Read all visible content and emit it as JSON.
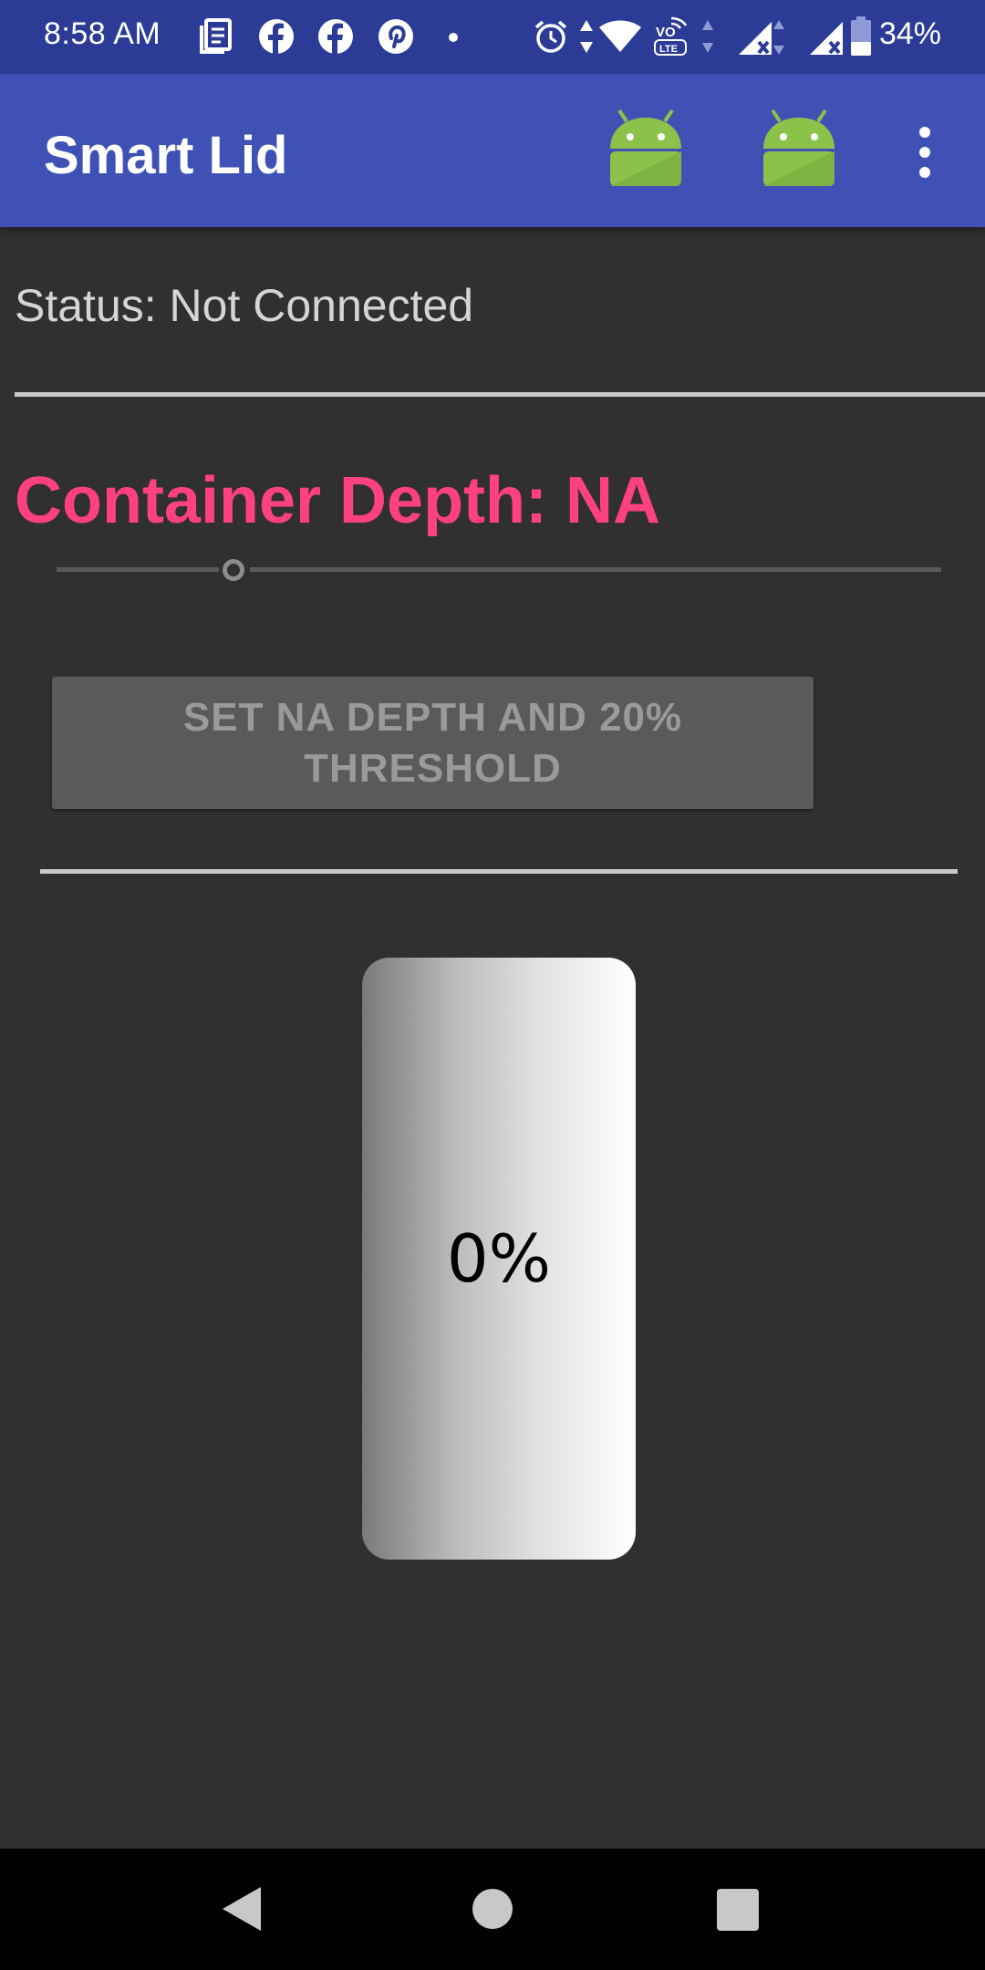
{
  "status_bar": {
    "time": "8:58 AM",
    "battery_percent": "34%",
    "icons": [
      "news-icon",
      "facebook-icon",
      "facebook-icon",
      "pinterest-icon",
      "notification-dot-icon",
      "alarm-icon",
      "data-arrows-icon",
      "wifi-icon",
      "volte-icon",
      "signal-icon",
      "signal-icon",
      "battery-icon"
    ]
  },
  "app_bar": {
    "title": "Smart Lid",
    "actions": [
      "android-icon",
      "android-icon",
      "overflow-menu-icon"
    ]
  },
  "main": {
    "status_text": "Status: Not Connected",
    "depth_label": "Container Depth: NA",
    "slider_value": 0.21,
    "set_button_label": "SET NA DEPTH AND 20% THRESHOLD",
    "level_percent": "0%"
  },
  "colors": {
    "status_bar": "#2c3c96",
    "app_bar": "#3f51b5",
    "accent": "#ff4081",
    "background": "#303030",
    "android_green": "#8bc34a"
  },
  "nav_bar": {
    "buttons": [
      "back-icon",
      "home-icon",
      "recents-icon"
    ]
  }
}
